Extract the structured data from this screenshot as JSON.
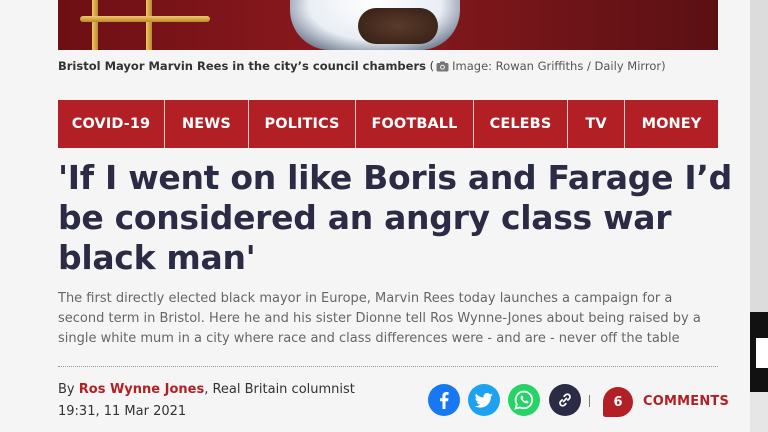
{
  "caption": {
    "main": "Bristol Mayor Marvin Rees in the city’s council chambers",
    "open": " (",
    "credit": "Image: Rowan Griffiths / Daily Mirror",
    "close": ")"
  },
  "nav": {
    "items": [
      "COVID-19",
      "NEWS",
      "POLITICS",
      "FOOTBALL",
      "CELEBS",
      "TV",
      "MONEY"
    ]
  },
  "article": {
    "headline": "'If I went on like Boris and Farage I’d be considered an angry class war black man'",
    "standfirst": "The first directly elected black mayor in Europe, Marvin Rees today launches a campaign for a second term in Bristol. Here he and his sister Dionne tell Ros Wynne-Jones about being raised by a single white mum in a city where race and class differences were - and are - never off the table",
    "byline_prefix": "By ",
    "author": "Ros Wynne Jones",
    "author_role": ", Real Britain columnist",
    "date": "19:31, 11 Mar 2021"
  },
  "comments": {
    "count": "6",
    "label": "COMMENTS"
  },
  "colors": {
    "brand_red": "#b21f24",
    "headline": "#2b2b45",
    "facebook": "#1877f2",
    "twitter": "#1da1f2",
    "whatsapp": "#25d366"
  },
  "icons": [
    "camera-icon",
    "facebook-icon",
    "twitter-icon",
    "whatsapp-icon",
    "link-icon"
  ]
}
